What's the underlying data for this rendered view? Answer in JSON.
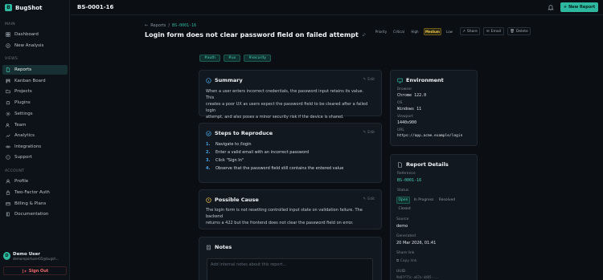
{
  "app": {
    "name": "BugShot"
  },
  "sidebar": {
    "main_label": "MAIN",
    "main_items": [
      {
        "label": "Dashboard",
        "icon": "grid-icon"
      },
      {
        "label": "New Analysis",
        "icon": "plus-circle-icon"
      }
    ],
    "views_label": "VIEWS",
    "views_items": [
      {
        "label": "Reports",
        "icon": "file-icon",
        "active": true
      },
      {
        "label": "Kanban Board",
        "icon": "kanban-icon"
      },
      {
        "label": "Projects",
        "icon": "folder-icon"
      },
      {
        "label": "Plugins",
        "icon": "puzzle-icon"
      },
      {
        "label": "Settings",
        "icon": "gear-icon"
      },
      {
        "label": "Team",
        "icon": "users-icon"
      },
      {
        "label": "Analytics",
        "icon": "chart-icon"
      },
      {
        "label": "Integrations",
        "icon": "link-icon"
      },
      {
        "label": "Support",
        "icon": "help-icon"
      }
    ],
    "account_label": "ACCOUNT",
    "account_items": [
      {
        "label": "Profile",
        "icon": "user-icon"
      },
      {
        "label": "Two-Factor Auth",
        "icon": "lock-icon"
      },
      {
        "label": "Billing & Plans",
        "icon": "card-icon"
      },
      {
        "label": "Documentation",
        "icon": "book-icon"
      }
    ],
    "user": {
      "initial": "D",
      "name": "Demo User",
      "email": "demoreportuser05@bugsh..."
    },
    "sign_out": "Sign Out"
  },
  "topbar": {
    "title": "BS-0001-16",
    "new_report": "New Report"
  },
  "breadcrumb": {
    "parent": "Reports",
    "separator": "/",
    "current": "BS-0001-16"
  },
  "page": {
    "title": "Login form does not clear password field on failed attempt"
  },
  "priority": {
    "label": "Priority",
    "options": [
      "Critical",
      "High",
      "Medium",
      "Low"
    ],
    "selected": "Medium"
  },
  "actions": {
    "share": "Share",
    "email": "Email",
    "delete": "Delete"
  },
  "tags": [
    "#auth",
    "#ux",
    "#security"
  ],
  "summary": {
    "title": "Summary",
    "edit": "Edit",
    "lines": [
      "When a user enters incorrect credentials, the password input retains its value. This",
      "creates a poor UX as users expect the password field to be cleared after a failed login",
      "attempt, and also poses a minor security risk if the device is shared."
    ]
  },
  "steps": {
    "title": "Steps to Reproduce",
    "edit": "Edit",
    "items": [
      "Navigate to /login",
      "Enter a valid email with an incorrect password",
      "Click \"Sign In\"",
      "Observe that the password field still contains the entered value"
    ]
  },
  "cause": {
    "title": "Possible Cause",
    "edit": "Edit",
    "lines": [
      "The login form is not resetting controlled input state on validation failure. The backend",
      "returns a 422 but the frontend does not clear the password field on error."
    ]
  },
  "notes": {
    "title": "Notes",
    "placeholder": "Add internal notes about this report..."
  },
  "environment": {
    "title": "Environment",
    "browser_label": "Browser",
    "browser": "Chrome 122.0",
    "os_label": "OS",
    "os": "Windows 11",
    "viewport_label": "Viewport",
    "viewport": "1440x900",
    "url_label": "URL",
    "url": "https://app.acme.example/login"
  },
  "details": {
    "title": "Report Details",
    "ref_label": "Reference",
    "ref": "BS-0001-16",
    "status_label": "Status",
    "statuses": [
      "Open",
      "In Progress",
      "Resolved",
      "Closed"
    ],
    "status_selected": "Open",
    "source_label": "Source",
    "source": "demo",
    "generated_label": "Generated",
    "generated": "20 Mar 2026, 01:41",
    "share_label": "Share link",
    "copy": "Copy link",
    "uuid_label": "UUID",
    "uuid": "9b07f75c-a67a-4d85-..."
  },
  "colors": {
    "accent": "#2fb8a0",
    "bg": "#0b0f14",
    "card": "#121820",
    "priority_selected": "#f1c84b",
    "danger": "#f06a6a"
  }
}
